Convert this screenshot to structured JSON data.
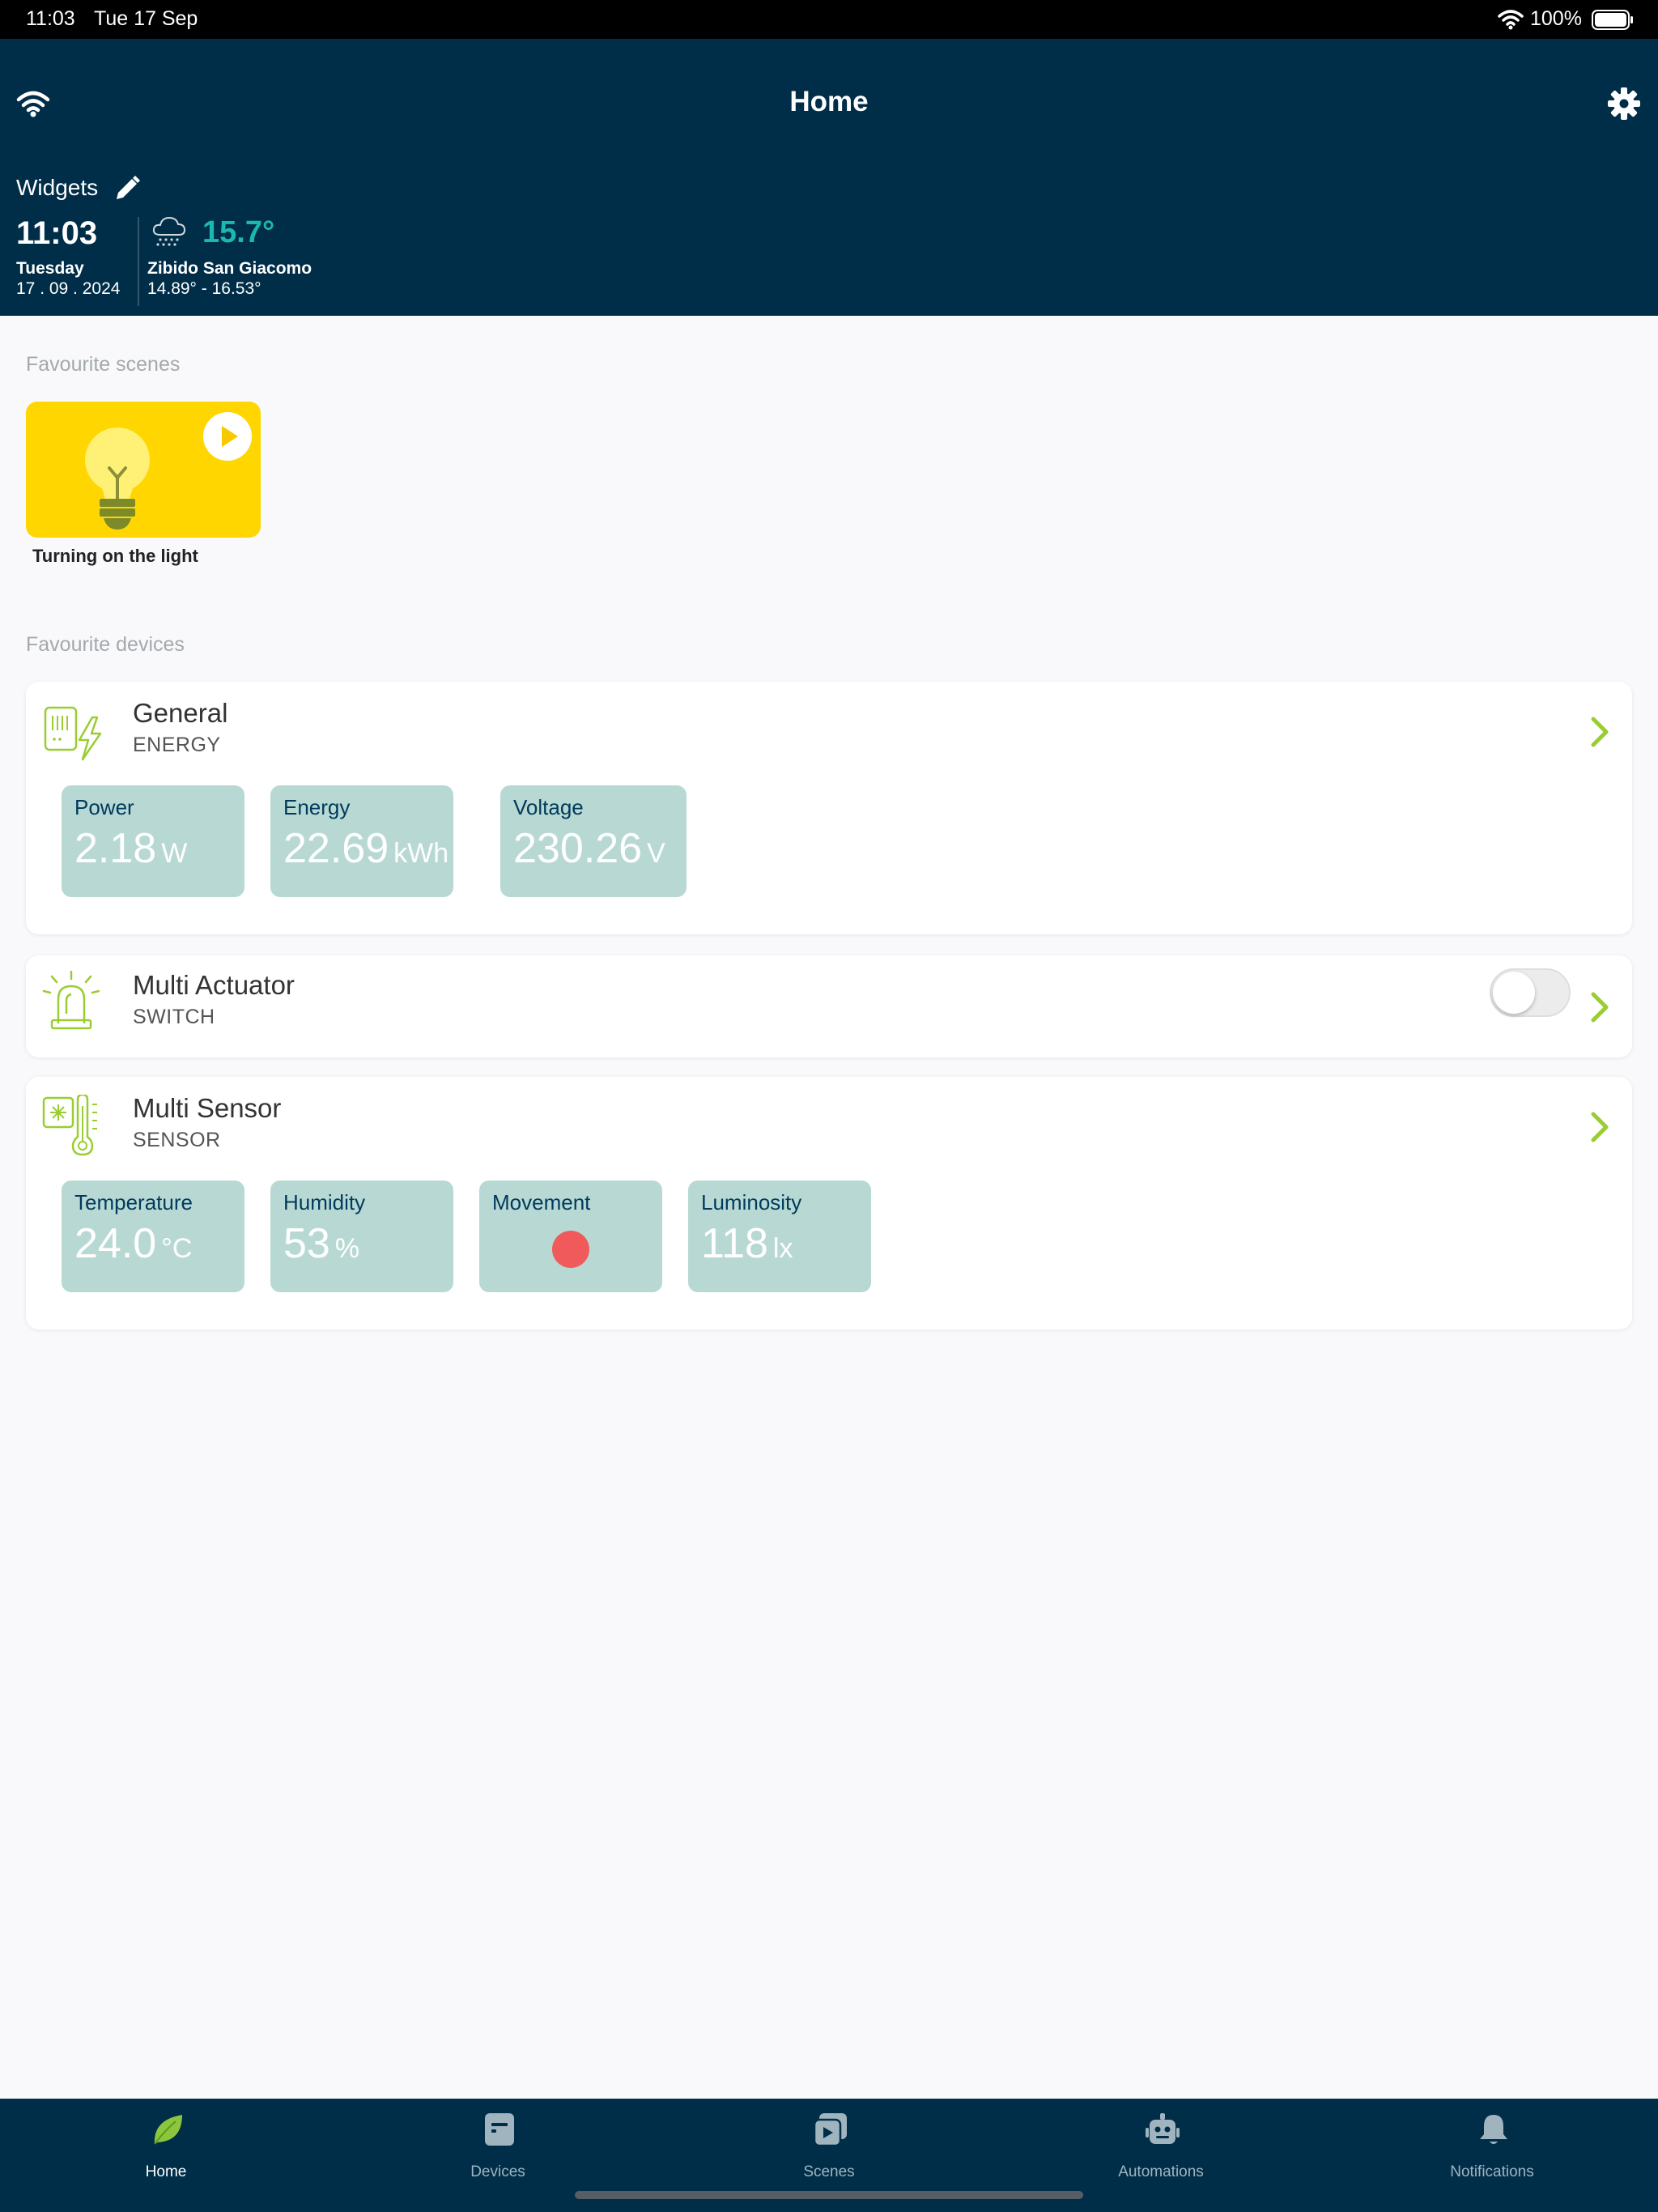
{
  "status_bar": {
    "time": "11:03",
    "date": "Tue 17 Sep",
    "battery": "100%"
  },
  "header": {
    "title": "Home",
    "widgets_label": "Widgets"
  },
  "clock_widget": {
    "time": "11:03",
    "day": "Tuesday",
    "date": "17 . 09 . 2024"
  },
  "weather_widget": {
    "temperature": "15.7°",
    "location": "Zibido San Giacomo",
    "range": "14.89° - 16.53°"
  },
  "scenes": {
    "section_label": "Favourite scenes",
    "items": [
      {
        "name": "Turning on the light"
      }
    ]
  },
  "devices": {
    "section_label": "Favourite devices",
    "items": [
      {
        "name": "General",
        "type": "ENERGY",
        "metrics": [
          {
            "label": "Power",
            "value": "2.18",
            "unit": "W"
          },
          {
            "label": "Energy",
            "value": "22.69",
            "unit": "kWh"
          },
          {
            "label": "Voltage",
            "value": "230.26",
            "unit": "V"
          }
        ]
      },
      {
        "name": "Multi Actuator",
        "type": "SWITCH",
        "switch_on": false
      },
      {
        "name": "Multi Sensor",
        "type": "SENSOR",
        "metrics": [
          {
            "label": "Temperature",
            "value": "24.0",
            "unit": "°C"
          },
          {
            "label": "Humidity",
            "value": "53",
            "unit": "%"
          },
          {
            "label": "Movement",
            "status_color": "#f05a5a"
          },
          {
            "label": "Luminosity",
            "value": "118",
            "unit": "lx"
          }
        ]
      }
    ]
  },
  "tabs": [
    {
      "label": "Home",
      "icon": "leaf-icon",
      "active": true
    },
    {
      "label": "Devices",
      "icon": "device-icon",
      "active": false
    },
    {
      "label": "Scenes",
      "icon": "scenes-icon",
      "active": false
    },
    {
      "label": "Automations",
      "icon": "robot-icon",
      "active": false
    },
    {
      "label": "Notifications",
      "icon": "bell-icon",
      "active": false
    }
  ],
  "colors": {
    "header_bg": "#002e48",
    "accent_green": "#9acd32",
    "temp_teal": "#1ab8b0",
    "tile_bg": "#b8d9d3",
    "scene_yellow": "#ffd600"
  }
}
